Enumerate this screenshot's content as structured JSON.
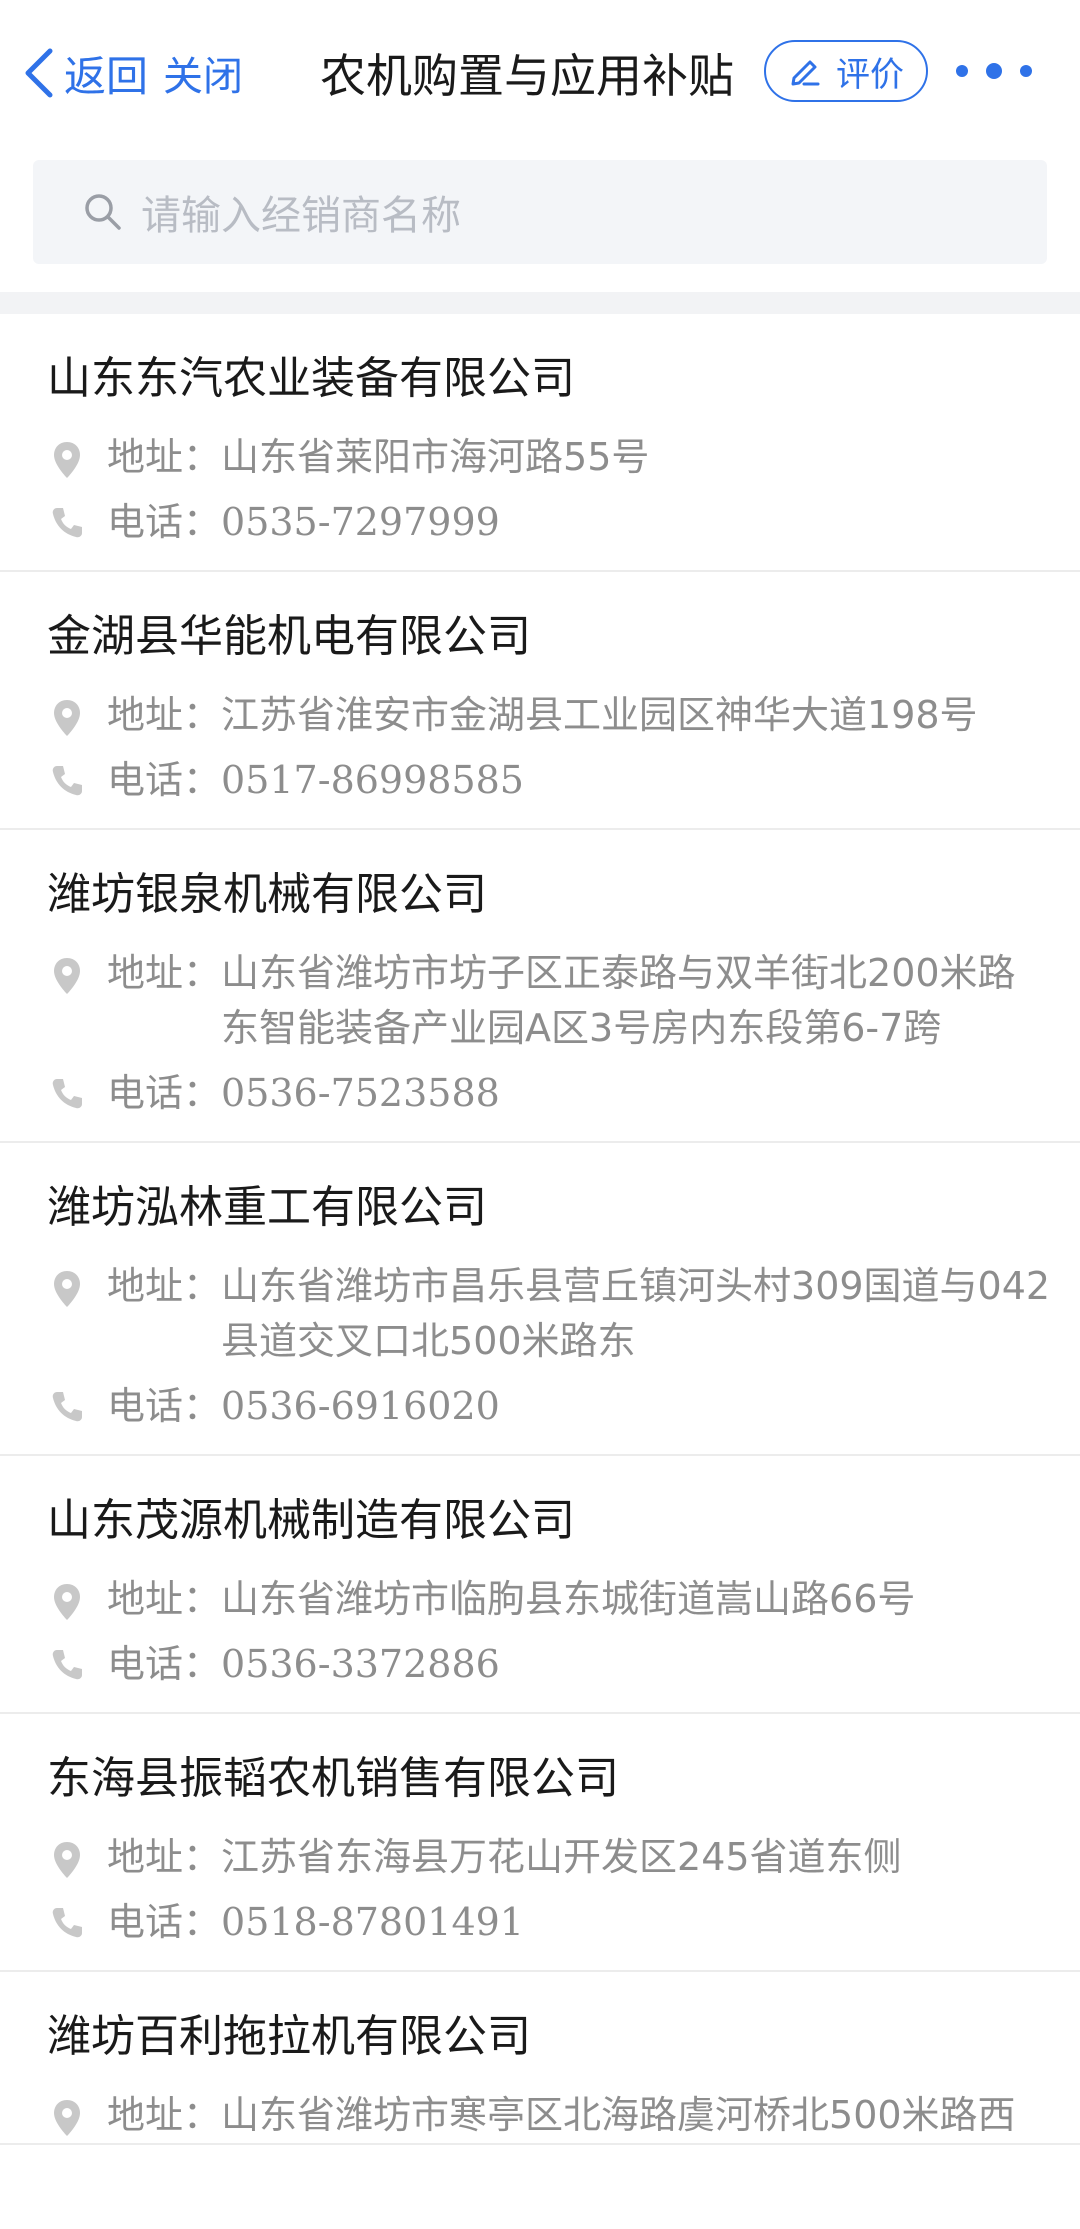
{
  "header": {
    "back_label": "返回",
    "close_label": "关闭",
    "title": "农机购置与应用补贴",
    "rate_label": "评价"
  },
  "search": {
    "placeholder": "请输入经销商名称"
  },
  "labels": {
    "address": "地址：",
    "phone": "电话："
  },
  "dealers": [
    {
      "name": "山东东汽农业装备有限公司",
      "address": "山东省莱阳市海河路55号",
      "phone": "0535-7297999"
    },
    {
      "name": "金湖县华能机电有限公司",
      "address": "江苏省淮安市金湖县工业园区神华大道198号",
      "phone": "0517-86998585"
    },
    {
      "name": "潍坊银泉机械有限公司",
      "address": "山东省潍坊市坊子区正泰路与双羊街北200米路东智能装备产业园A区3号房内东段第6-7跨",
      "phone": "0536-7523588"
    },
    {
      "name": "潍坊泓林重工有限公司",
      "address": "山东省潍坊市昌乐县营丘镇河头村309国道与042县道交叉口北500米路东",
      "phone": "0536-6916020"
    },
    {
      "name": "山东茂源机械制造有限公司",
      "address": "山东省潍坊市临朐县东城街道嵩山路66号",
      "phone": "0536-3372886"
    },
    {
      "name": "东海县振韬农机销售有限公司",
      "address": "江苏省东海县万花山开发区245省道东侧",
      "phone": "0518-87801491"
    },
    {
      "name": "潍坊百利拖拉机有限公司",
      "address": "山东省潍坊市寒亭区北海路虞河桥北500米路西",
      "phone": ""
    }
  ],
  "icons": {
    "back": "chevron-left-icon",
    "rate": "edit-icon",
    "more": "more-icon",
    "search": "search-icon",
    "address": "location-pin-icon",
    "phone": "phone-icon"
  },
  "colors": {
    "accent": "#2f72e8",
    "muted_text": "#8d8d8d",
    "icon_gray": "#c8c8c8"
  }
}
